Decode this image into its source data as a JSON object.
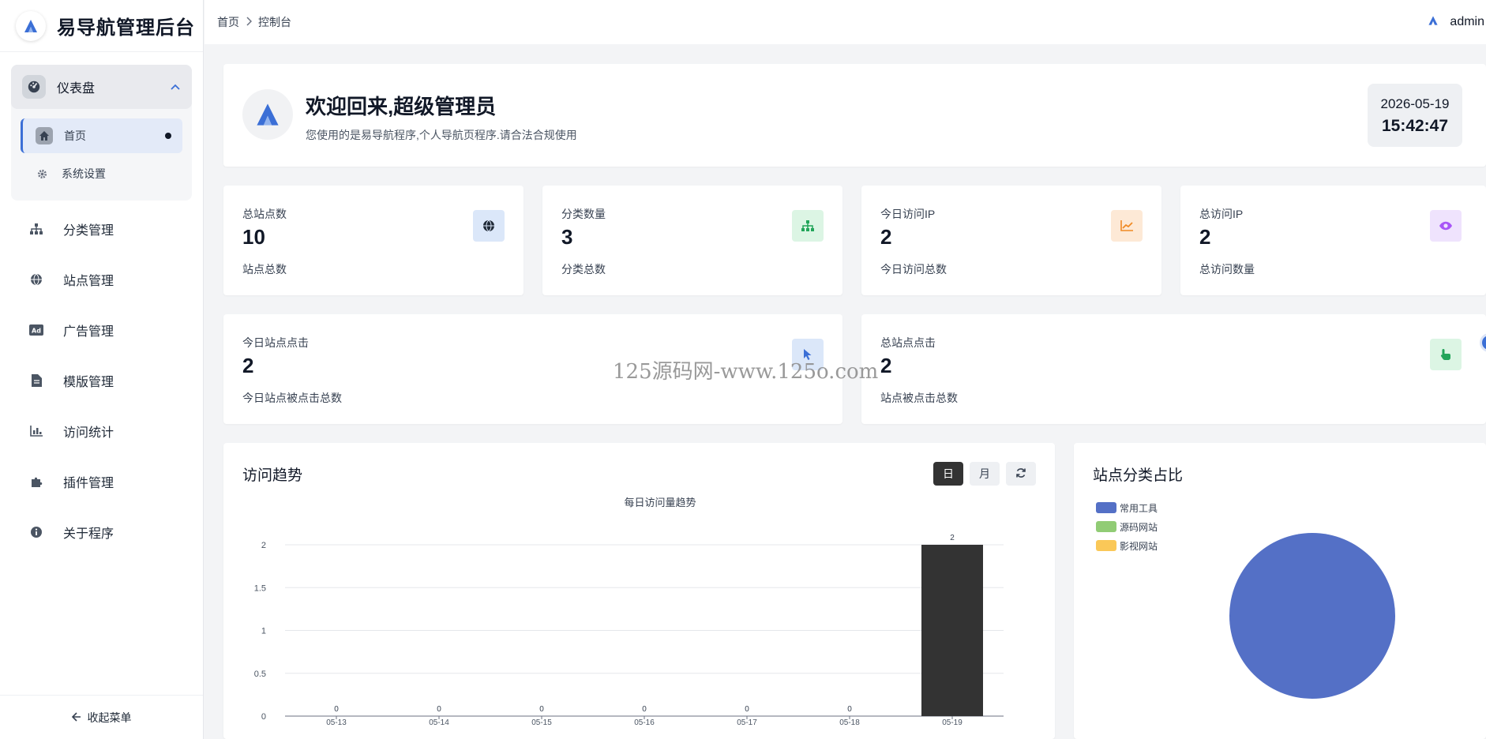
{
  "brand": {
    "title": "易导航管理后台"
  },
  "sidebar": {
    "group": {
      "label": "仪表盘",
      "items": [
        {
          "label": "首页",
          "icon": "home-icon",
          "active": true
        },
        {
          "label": "系统设置",
          "icon": "gear-icon",
          "active": false
        }
      ]
    },
    "items": [
      {
        "label": "分类管理",
        "icon": "sitemap-icon"
      },
      {
        "label": "站点管理",
        "icon": "globe-icon"
      },
      {
        "label": "广告管理",
        "icon": "ad-icon"
      },
      {
        "label": "模版管理",
        "icon": "file-icon"
      },
      {
        "label": "访问统计",
        "icon": "bar-chart-icon"
      },
      {
        "label": "插件管理",
        "icon": "puzzle-icon"
      },
      {
        "label": "关于程序",
        "icon": "info-icon"
      }
    ],
    "collapse_label": "收起菜单"
  },
  "topbar": {
    "breadcrumb": [
      "首页",
      "控制台"
    ],
    "user": "admin"
  },
  "welcome": {
    "title": "欢迎回来,超级管理员",
    "subtitle": "您使用的是易导航程序,个人导航页程序.请合法合规使用",
    "date": "2026-05-19",
    "time": "15:42:47"
  },
  "stats": [
    {
      "label": "总站点数",
      "value": "10",
      "desc": "站点总数",
      "icon": "globe-icon",
      "color": "#3b6fd6",
      "bg": "#dbe7f9"
    },
    {
      "label": "分类数量",
      "value": "3",
      "desc": "分类总数",
      "icon": "sitemap-icon",
      "color": "#22a55a",
      "bg": "#dcf5e4"
    },
    {
      "label": "今日访问IP",
      "value": "2",
      "desc": "今日访问总数",
      "icon": "line-chart-icon",
      "color": "#f08a24",
      "bg": "#fde9d6"
    },
    {
      "label": "总访问IP",
      "value": "2",
      "desc": "总访问数量",
      "icon": "eye-icon",
      "color": "#a855f7",
      "bg": "#efe3fd"
    },
    {
      "label": "今日站点点击",
      "value": "2",
      "desc": "今日站点被点击总数",
      "icon": "cursor-icon",
      "color": "#3b6fd6",
      "bg": "#dbe7f9"
    },
    {
      "label": "总站点点击",
      "value": "2",
      "desc": "站点被点击总数",
      "icon": "pointer-hand-icon",
      "color": "#22a55a",
      "bg": "#dcf5e4"
    }
  ],
  "trend": {
    "title": "访问趋势",
    "buttons": [
      "日",
      "月"
    ],
    "refresh_icon": "refresh-icon"
  },
  "pie": {
    "title": "站点分类占比"
  },
  "chart_data": [
    {
      "type": "bar",
      "title": "每日访问量趋势",
      "categories": [
        "05-13",
        "05-14",
        "05-15",
        "05-16",
        "05-17",
        "05-18",
        "05-19"
      ],
      "values": [
        0,
        0,
        0,
        0,
        0,
        0,
        2
      ],
      "ylim": [
        0,
        2
      ],
      "yticks": [
        "0",
        "0.5",
        "1",
        "1.5",
        "2"
      ],
      "bar_color": "#333333",
      "grid": true
    },
    {
      "type": "pie",
      "legend": [
        {
          "name": "常用工具",
          "color": "#5470c6"
        },
        {
          "name": "源码网站",
          "color": "#91cc75"
        },
        {
          "name": "影视网站",
          "color": "#fac858"
        }
      ],
      "values": [
        1,
        0,
        0
      ],
      "legend_position": "top-left"
    }
  ],
  "watermark": "125源码网-www.125o.com"
}
